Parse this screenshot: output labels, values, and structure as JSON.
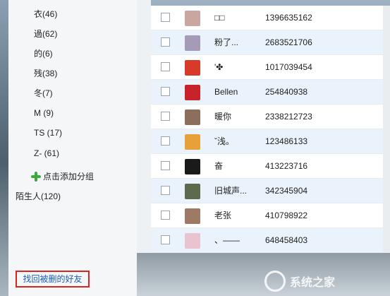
{
  "groups": [
    {
      "label": "衣(46)"
    },
    {
      "label": "過(62)"
    },
    {
      "label": "的(6)"
    },
    {
      "label": "残(38)"
    },
    {
      "label": "冬(7)"
    },
    {
      "label": "M  (9)"
    },
    {
      "label": "TS (17)"
    },
    {
      "label": "Z- (61)"
    }
  ],
  "add_group_label": "点击添加分组",
  "stranger_label": "陌生人(120)",
  "find_deleted_button": "找回被删的好友",
  "friends": [
    {
      "nickname": "□□",
      "qq": "1396635162",
      "avatar_color": "#c9a6a0"
    },
    {
      "nickname": "粉了...",
      "qq": "2683521706",
      "avatar_color": "#a59bb6"
    },
    {
      "nickname": "'✤",
      "qq": "1017039454",
      "avatar_color": "#d83a2a"
    },
    {
      "nickname": "Bellen",
      "qq": "254840938",
      "avatar_color": "#c8222a"
    },
    {
      "nickname": "暖你",
      "qq": "2338212723",
      "avatar_color": "#8b6f5c"
    },
    {
      "nickname": "ˇ浅。",
      "qq": "123486133",
      "avatar_color": "#e8a03a"
    },
    {
      "nickname": "奋",
      "qq": "413223716",
      "avatar_color": "#1a1a1a"
    },
    {
      "nickname": "旧城声...",
      "qq": "342345904",
      "avatar_color": "#5c6b4e"
    },
    {
      "nickname": "老张",
      "qq": "410798922",
      "avatar_color": "#9c7a66"
    },
    {
      "nickname": "、——",
      "qq": "648458403",
      "avatar_color": "#e9c3cf"
    }
  ],
  "watermark_text": "系统之家"
}
